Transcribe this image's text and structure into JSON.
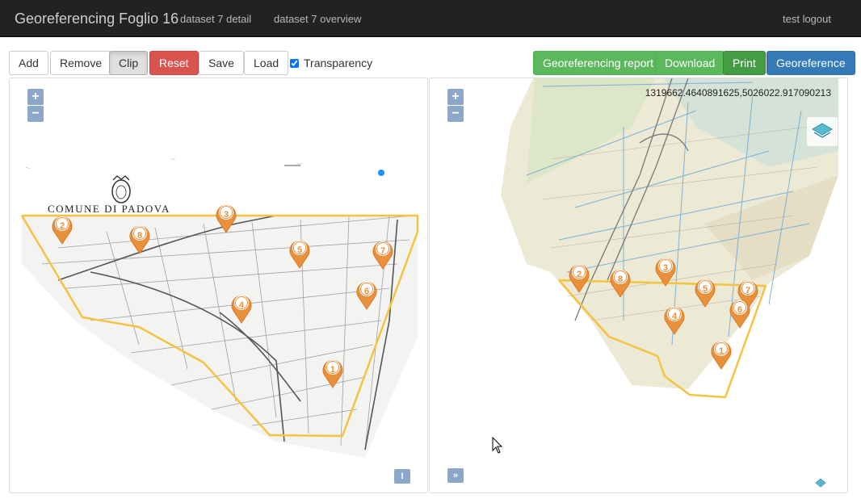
{
  "navbar": {
    "brand": "Georeferencing Foglio 16",
    "links": [
      "dataset 7 detail",
      "dataset 7 overview"
    ],
    "user": "test logout"
  },
  "toolbar": {
    "add": "Add",
    "remove": "Remove",
    "clip": "Clip",
    "reset": "Reset",
    "save": "Save",
    "load": "Load",
    "transparency_label": "Transparency",
    "transparency_checked": true,
    "report": "Georeferencing report",
    "download": "Download",
    "print": "Print",
    "georeference": "Georeference"
  },
  "left_map": {
    "zoom_in": "+",
    "zoom_out": "−",
    "map_title": "COMUNE DI PADOVA",
    "markers": [
      "1",
      "2",
      "3",
      "4",
      "5",
      "6",
      "7",
      "8"
    ],
    "corner_button": "I"
  },
  "right_map": {
    "zoom_in": "+",
    "zoom_out": "−",
    "coordinate_readout": "1319662.4640891625,5026022.917090213",
    "markers": [
      "1",
      "2",
      "3",
      "4",
      "5",
      "6",
      "7",
      "8"
    ],
    "corner_button": "»"
  },
  "colors": {
    "navbar": "#222222",
    "marker": "#e8903c",
    "clip_outline": "#f5c242",
    "reset": "#d9534f",
    "success": "#5cb85c",
    "primary": "#337ab7"
  },
  "icons": [
    "layers-icon",
    "cursor-icon",
    "emblem-icon"
  ]
}
